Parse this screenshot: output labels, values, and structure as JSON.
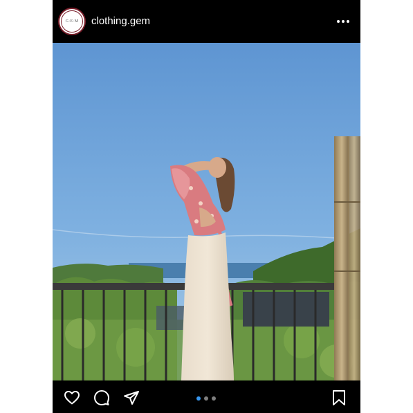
{
  "post": {
    "username": "clothing.gem",
    "avatar_monogram": "G·E·M",
    "more_icon": "more-horizontal-icon",
    "carousel": {
      "total_slides": 3,
      "current_slide": 1
    }
  },
  "actions": {
    "like_icon": "heart-icon",
    "comment_icon": "comment-icon",
    "share_icon": "send-icon",
    "save_icon": "bookmark-icon"
  },
  "colors": {
    "background": "#000000",
    "text": "#ffffff",
    "active_dot": "#3897f0",
    "inactive_dot": "#7f7f7f",
    "avatar_ring": "#7a1f2b"
  }
}
